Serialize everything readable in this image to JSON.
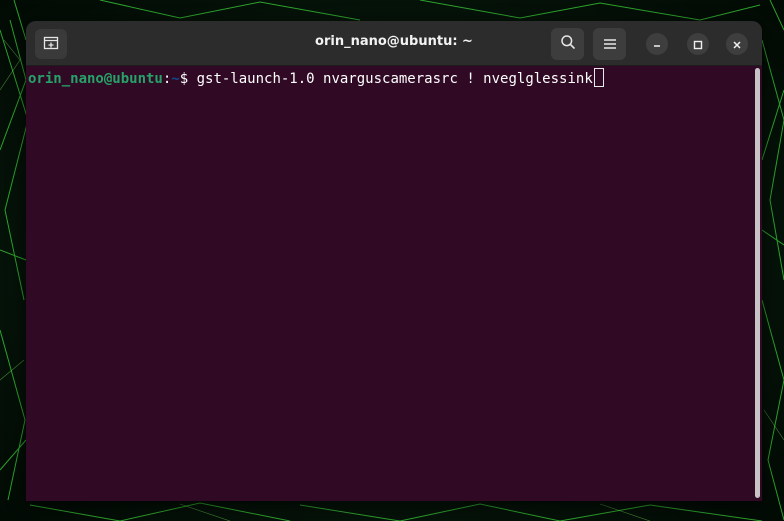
{
  "window": {
    "title": "orin_nano@ubuntu: ~"
  },
  "terminal": {
    "prompt_user": "orin_nano@ubuntu",
    "prompt_colon": ":",
    "prompt_path": "~",
    "prompt_symbol": "$ ",
    "command": "gst-launch-1.0 nvarguscamerasrc ! nveglglessink"
  },
  "icons": {
    "new_tab": "new-tab-icon",
    "search": "search-icon",
    "menu": "hamburger-menu-icon",
    "minimize": "minimize-icon",
    "maximize": "maximize-icon",
    "close": "close-icon"
  },
  "colors": {
    "terminal_bg": "#300a24",
    "titlebar_bg": "#2c2c2c",
    "prompt_user": "#26a269",
    "prompt_path": "#12488b",
    "wallpaper_accent": "#39ff14"
  }
}
